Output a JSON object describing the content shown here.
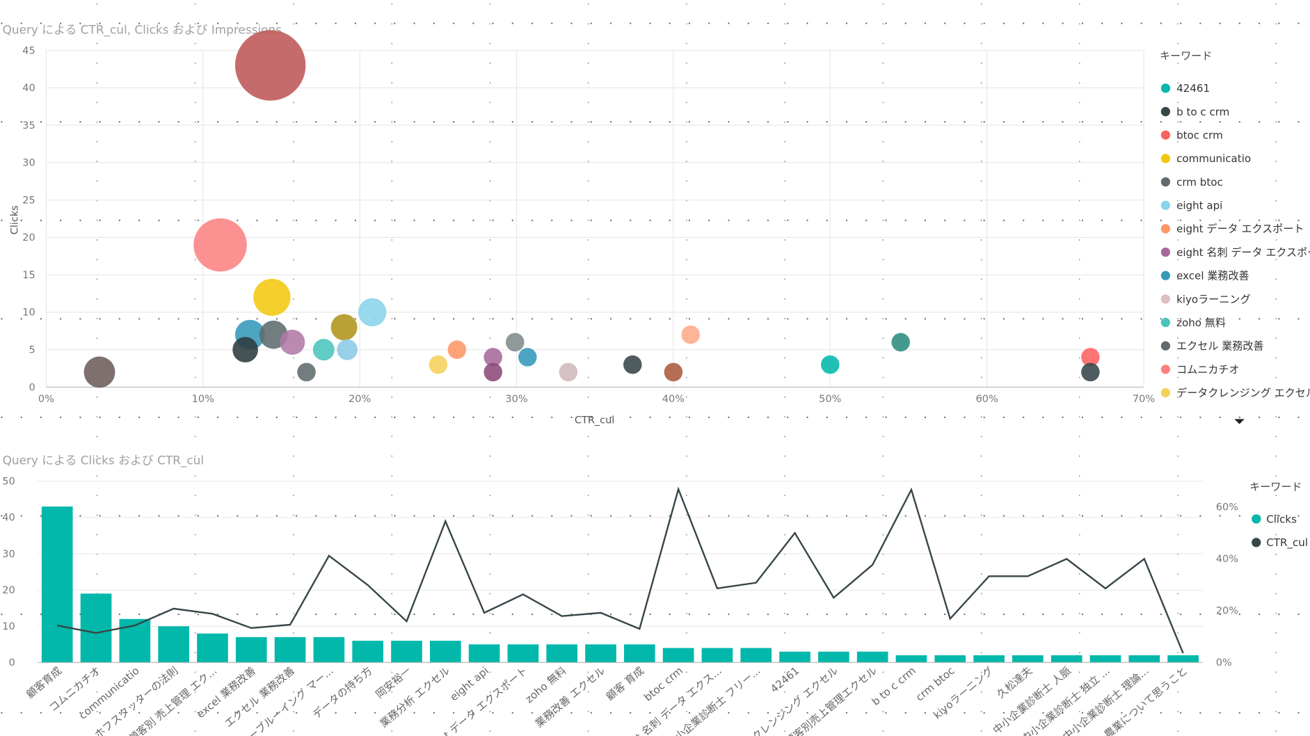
{
  "chart_data": [
    {
      "type": "scatter",
      "title": "Query による CTR_cul, Clicks および Impressions",
      "xlabel": "CTR_cul",
      "ylabel": "Clicks",
      "xlim": [
        0,
        70
      ],
      "ylim": [
        0,
        45
      ],
      "x_ticks": [
        "0%",
        "10%",
        "20%",
        "30%",
        "40%",
        "50%",
        "60%",
        "70%"
      ],
      "y_ticks": [
        "0",
        "5",
        "10",
        "15",
        "20",
        "25",
        "30",
        "35",
        "40",
        "45"
      ],
      "grid": true,
      "size_encodes": "Impressions",
      "legend": {
        "title": "キーワード",
        "placement": "right",
        "items": [
          {
            "label": "42461",
            "color": "#01B8AA"
          },
          {
            "label": "b to c crm",
            "color": "#374649"
          },
          {
            "label": "btoc crm",
            "color": "#FD625E"
          },
          {
            "label": "communicatio",
            "color": "#F2C80F"
          },
          {
            "label": "crm btoc",
            "color": "#5F6B6D"
          },
          {
            "label": "eight api",
            "color": "#8AD4EB"
          },
          {
            "label": "eight データ エクスポート",
            "color": "#FE9666"
          },
          {
            "label": "eight 名刺 データ エクスポート",
            "color": "#A66999"
          },
          {
            "label": "excel 業務改善",
            "color": "#3599B8"
          },
          {
            "label": "kiyoラーニング",
            "color": "#DFBFBF"
          },
          {
            "label": "zoho 無料",
            "color": "#4AC5BB"
          },
          {
            "label": "エクセル 業務改善",
            "color": "#5F6B6D"
          },
          {
            "label": "コムニカチオ",
            "color": "#FB8281"
          },
          {
            "label": "データクレンジング エクセル",
            "color": "#F4D25A"
          }
        ]
      },
      "points": [
        {
          "x": 14.3,
          "y": 43,
          "color": "#BE5656"
        },
        {
          "x": 11.1,
          "y": 19,
          "color": "#FB8281"
        },
        {
          "x": 14.4,
          "y": 12,
          "color": "#F2C80F"
        },
        {
          "x": 20.8,
          "y": 10,
          "color": "#8AD4EB"
        },
        {
          "x": 19.0,
          "y": 8,
          "color": "#B0941A"
        },
        {
          "x": 13.0,
          "y": 7,
          "color": "#3599B8"
        },
        {
          "x": 14.5,
          "y": 7,
          "color": "#5F6B6D"
        },
        {
          "x": 15.7,
          "y": 6,
          "color": "#B07AA6"
        },
        {
          "x": 12.7,
          "y": 5,
          "color": "#2C3B3D"
        },
        {
          "x": 17.7,
          "y": 5,
          "color": "#4AC5BB"
        },
        {
          "x": 19.2,
          "y": 5,
          "color": "#8AC8E6"
        },
        {
          "x": 3.4,
          "y": 2,
          "color": "#6E5B5B"
        },
        {
          "x": 16.6,
          "y": 2,
          "color": "#5F6B6D"
        },
        {
          "x": 25.0,
          "y": 3,
          "color": "#F4D25A"
        },
        {
          "x": 26.2,
          "y": 5,
          "color": "#FE9666"
        },
        {
          "x": 28.5,
          "y": 4,
          "color": "#A66999"
        },
        {
          "x": 28.5,
          "y": 2,
          "color": "#8C4A7A"
        },
        {
          "x": 29.9,
          "y": 6,
          "color": "#7F8B8C"
        },
        {
          "x": 30.7,
          "y": 4,
          "color": "#3599B8"
        },
        {
          "x": 33.3,
          "y": 2,
          "color": "#CFB8BC"
        },
        {
          "x": 37.4,
          "y": 3,
          "color": "#374649"
        },
        {
          "x": 40.0,
          "y": 2,
          "color": "#A85A3E"
        },
        {
          "x": 41.1,
          "y": 7,
          "color": "#FDAB89"
        },
        {
          "x": 50.0,
          "y": 3,
          "color": "#01B8AA"
        },
        {
          "x": 54.5,
          "y": 6,
          "color": "#2B8C80"
        },
        {
          "x": 66.6,
          "y": 4,
          "color": "#FD625E"
        },
        {
          "x": 66.6,
          "y": 2,
          "color": "#374649"
        }
      ]
    },
    {
      "type": "bar",
      "title": "Query による Clicks および CTR_cul",
      "ylim": [
        0,
        50
      ],
      "y2lim": [
        0,
        70
      ],
      "y_ticks": [
        "0",
        "10",
        "20",
        "30",
        "40",
        "50"
      ],
      "y2_ticks": [
        "0%",
        "20%",
        "40%",
        "60%"
      ],
      "grid": true,
      "legend": {
        "title": "キーワード",
        "placement": "right",
        "items": [
          {
            "label": "Clicks",
            "color": "#01B8AA"
          },
          {
            "label": "CTR_cul",
            "color": "#374649"
          }
        ]
      },
      "categories": [
        "顧客育成",
        "コムニカチオ",
        "communicatio",
        "ホフスタッターの法則",
        "顧客別 売上管理 エク...",
        "excel 業務改善",
        "エクセル 業務改善",
        "ヤッホーブルーイング マー...",
        "データの持ち方",
        "岡安裕一",
        "業務分析 エクセル",
        "eight api",
        "eight データ エクスポート",
        "zoho 無料",
        "業務改善 エクセル",
        "顧客 育成",
        "btoc crm",
        "eight 名刺 データ エクス...",
        "中小企業診断士 フリー...",
        "42461",
        "データクレンジング エクセル",
        "顧客別売上管理エクセル",
        "b to c crm",
        "crm btoc",
        "kiyoラーニング",
        "久松達夫",
        "中小企業診断士 人脈",
        "中小企業診断士 独立 ...",
        "中小企業診断士 理論...",
        "農業について思うこと"
      ],
      "series": [
        {
          "name": "Clicks",
          "type": "bar",
          "color": "#01B8AA",
          "values": [
            43,
            19,
            12,
            10,
            8,
            7,
            7,
            7,
            6,
            6,
            6,
            5,
            5,
            5,
            5,
            5,
            4,
            4,
            4,
            3,
            3,
            3,
            2,
            2,
            2,
            2,
            2,
            2,
            2,
            2
          ]
        },
        {
          "name": "CTR_cul",
          "type": "line",
          "axis": "right",
          "color": "#374649",
          "values": [
            14.3,
            11.4,
            14.3,
            20.8,
            18.8,
            13.3,
            14.6,
            41.2,
            29.9,
            15.9,
            54.5,
            19.2,
            26.3,
            17.9,
            19.2,
            13.0,
            66.9,
            28.6,
            30.8,
            50.0,
            25.0,
            37.7,
            66.7,
            16.9,
            33.3,
            33.3,
            40.0,
            28.6,
            40.0,
            3.6
          ]
        }
      ]
    }
  ]
}
